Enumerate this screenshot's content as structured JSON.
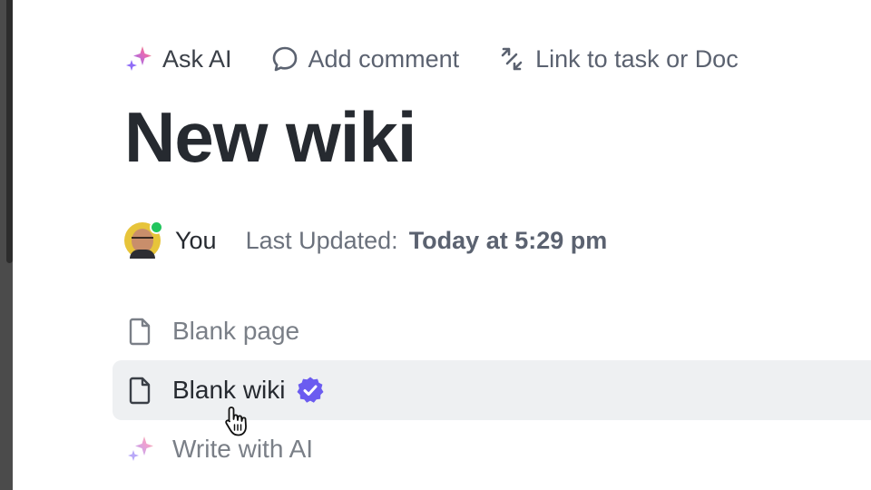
{
  "toolbar": {
    "ask_ai": "Ask AI",
    "add_comment": "Add comment",
    "link_task": "Link to task or Doc"
  },
  "page": {
    "title": "New wiki"
  },
  "meta": {
    "author": "You",
    "last_updated_label": "Last Updated:",
    "last_updated_value": "Today at 5:29 pm"
  },
  "options": {
    "blank_page": "Blank page",
    "blank_wiki": "Blank wiki",
    "write_ai": "Write with AI"
  },
  "colors": {
    "accent": "#6b5cf0",
    "online": "#22c55e",
    "ai_gradient_start": "#b06cf7",
    "ai_gradient_end": "#f5a35c"
  },
  "icons": {
    "ask_ai": "sparkle-icon",
    "add_comment": "comment-bubble-icon",
    "link_task": "link-arrows-icon",
    "blank_page": "document-icon",
    "blank_wiki": "document-icon",
    "verified": "verified-badge-icon",
    "write_ai": "sparkle-icon",
    "cursor": "hand-pointer-icon"
  }
}
